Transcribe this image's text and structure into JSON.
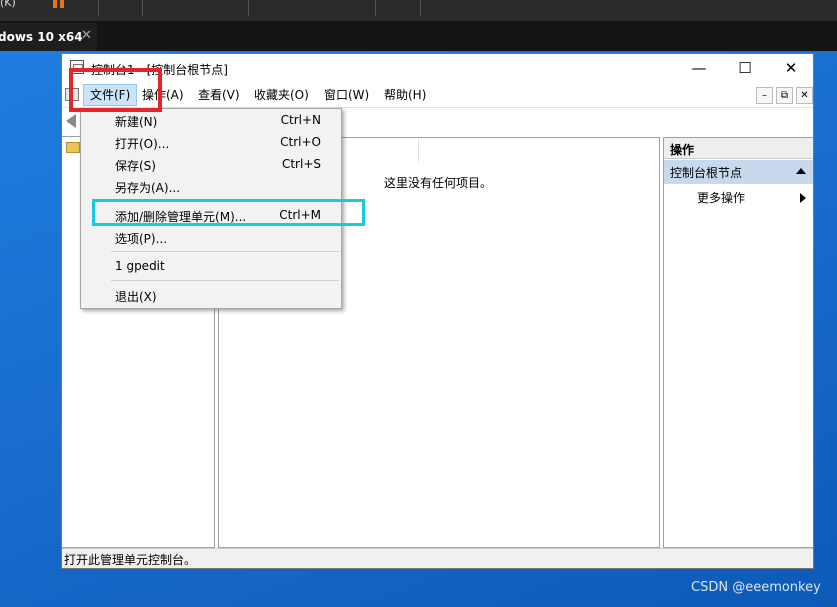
{
  "host": {
    "toolbar_cutoff_text": "(K)",
    "vm_tab_label": "dows 10 x64",
    "vm_tab_close": "✕"
  },
  "window": {
    "title": "控制台1 - [控制台根节点]",
    "minimize_glyph": "—",
    "maximize_glyph": "☐",
    "close_glyph": "✕"
  },
  "menubar": {
    "items": [
      "文件(F)",
      "操作(A)",
      "查看(V)",
      "收藏夹(O)",
      "窗口(W)",
      "帮助(H)"
    ],
    "active_index": 0,
    "mdi_minimize": "–",
    "mdi_restore": "⧉",
    "mdi_close": "✕"
  },
  "result_pane": {
    "empty_message": "这里没有任何项目。"
  },
  "action_pane": {
    "header": "操作",
    "section": "控制台根节点",
    "item": "更多操作"
  },
  "statusbar": {
    "text": "打开此管理单元控制台。"
  },
  "file_menu": {
    "items": [
      {
        "label": "新建(N)",
        "shortcut": "Ctrl+N"
      },
      {
        "label": "打开(O)...",
        "shortcut": "Ctrl+O"
      },
      {
        "label": "保存(S)",
        "shortcut": "Ctrl+S"
      },
      {
        "label": "另存为(A)...",
        "shortcut": ""
      },
      {
        "label": "添加/删除管理单元(M)...",
        "shortcut": "Ctrl+M"
      },
      {
        "label": "选项(P)...",
        "shortcut": ""
      },
      {
        "label": "1 gpedit",
        "shortcut": ""
      },
      {
        "label": "退出(X)",
        "shortcut": ""
      }
    ]
  },
  "annotations": {
    "highlight_file_menu_color": "#e3262b",
    "highlight_add_remove_color": "#18c9df"
  },
  "watermark": "CSDN @eeemonkey"
}
